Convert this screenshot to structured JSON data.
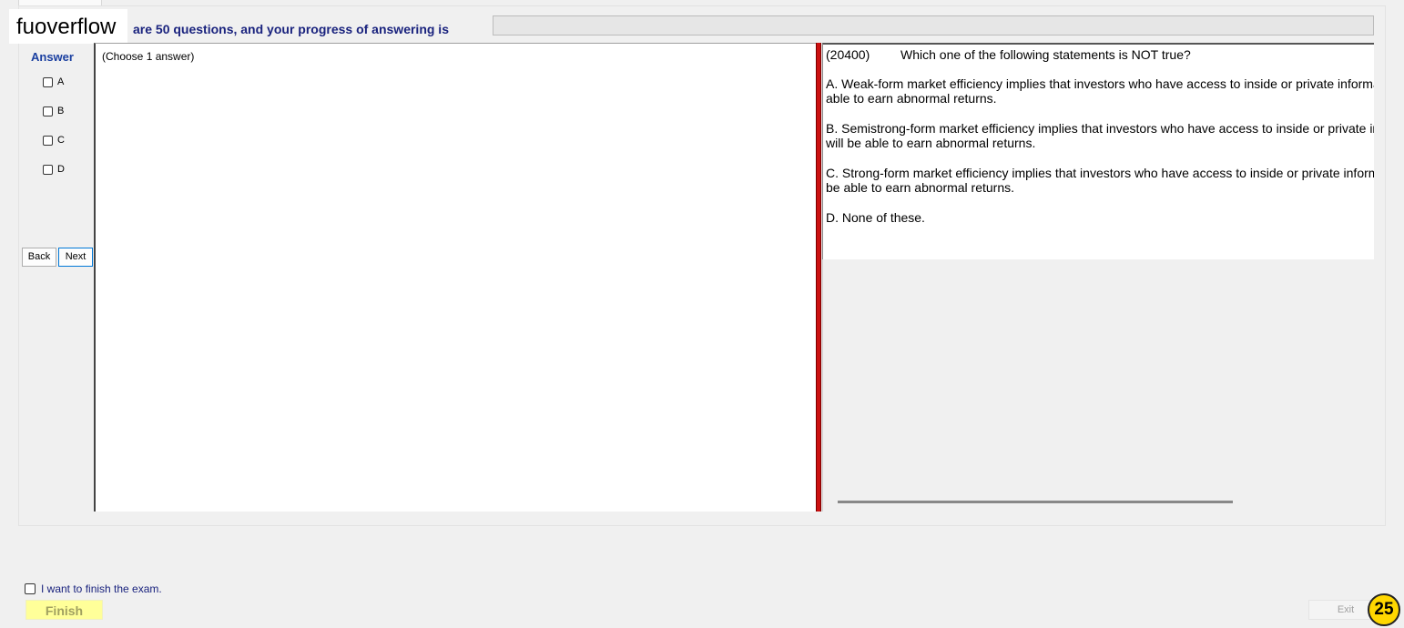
{
  "watermark": "fuoverflow",
  "progress": {
    "label": "are 50 questions, and your progress of answering is",
    "fraction": 0.0
  },
  "answer_panel": {
    "title": "Answer",
    "options": [
      "A",
      "B",
      "C",
      "D"
    ],
    "back_label": "Back",
    "next_label": "Next"
  },
  "answer_area": {
    "instruction": "(Choose 1 answer)"
  },
  "question": {
    "number": "(20400)",
    "text": "Which one of the following statements is NOT true?",
    "options": [
      "A.  Weak-form market efficiency implies that investors who have access to inside or private information will be",
      "able to earn abnormal returns.",
      "B.  Semistrong-form market efficiency implies that investors who have access to inside or private information",
      "will be able to earn abnormal returns.",
      "C.  Strong-form market efficiency implies that investors who have access to inside or private information will",
      "be able to earn abnormal returns.",
      "D.  None of these."
    ]
  },
  "footer": {
    "finish_check_label": "I want to finish the exam.",
    "finish_label": "Finish",
    "exit_label": "Exit",
    "timer": "25"
  },
  "colors": {
    "accent_blue": "#1a237e",
    "divider_red": "#cc1111",
    "finish_yellow": "#ffff99",
    "timer_gold": "#ffd700"
  }
}
